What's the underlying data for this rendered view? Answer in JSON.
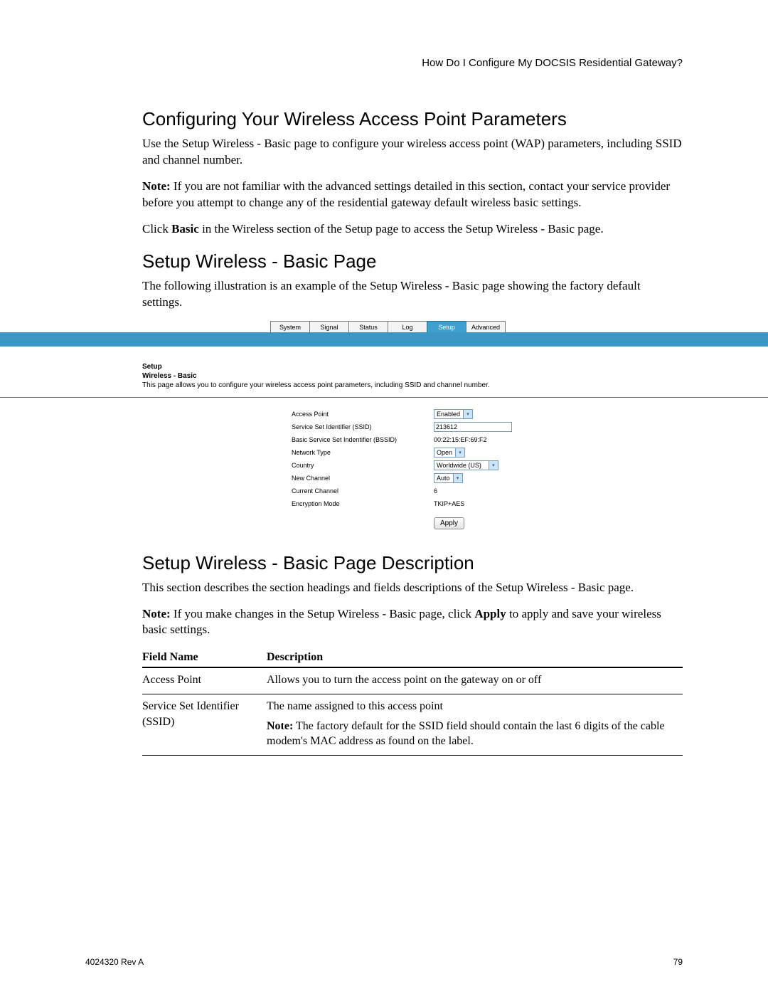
{
  "header": {
    "running": "How Do I Configure My DOCSIS Residential Gateway?"
  },
  "section1": {
    "heading": "Configuring Your Wireless Access Point Parameters",
    "p1": "Use the Setup Wireless - Basic page to configure your wireless access point (WAP) parameters, including SSID and channel number.",
    "p2_prefix": "Note:",
    "p2": " If you are not familiar with the advanced settings detailed in this section, contact your service provider before you attempt to change any of the residential gateway default wireless basic settings.",
    "p3_a": "Click ",
    "p3_bold": "Basic",
    "p3_b": " in the Wireless section of the Setup page to access the Setup Wireless - Basic page."
  },
  "section2": {
    "heading": "Setup Wireless - Basic Page",
    "p1": "The following illustration is an example of the Setup Wireless - Basic page showing the factory default settings."
  },
  "ui": {
    "tabs": {
      "system": "System",
      "signal": "Signal",
      "status": "Status",
      "log": "Log",
      "setup": "Setup",
      "advanced": "Advanced"
    },
    "titleblock": {
      "line1": "Setup",
      "line2": "Wireless - Basic",
      "desc": "This page allows you to configure your wireless access point parameters, including SSID and channel number."
    },
    "rows": {
      "access_point": {
        "label": "Access Point",
        "value": "Enabled"
      },
      "ssid": {
        "label": "Service Set Identifier (SSID)",
        "value": "213612"
      },
      "bssid": {
        "label": "Basic Service Set Indentifier (BSSID)",
        "value": "00:22:15:EF:69:F2"
      },
      "network_type": {
        "label": "Network Type",
        "value": "Open"
      },
      "country": {
        "label": "Country",
        "value": "Worldwide (US)"
      },
      "new_channel": {
        "label": "New Channel",
        "value": "Auto"
      },
      "current_channel": {
        "label": "Current Channel",
        "value": "6"
      },
      "encryption": {
        "label": "Encryption Mode",
        "value": "TKIP+AES"
      }
    },
    "apply": "Apply"
  },
  "section3": {
    "heading": "Setup Wireless - Basic Page Description",
    "p1": "This section describes the section headings and fields descriptions of the Setup Wireless - Basic page.",
    "p2_prefix": "Note:",
    "p2_a": " If you make changes in the Setup Wireless - Basic page, click ",
    "p2_bold": "Apply",
    "p2_b": " to apply and save your wireless basic settings."
  },
  "table": {
    "headers": {
      "field": "Field Name",
      "desc": "Description"
    },
    "rows": [
      {
        "field": "Access Point",
        "desc": "Allows you to turn the access point on the gateway on or off"
      },
      {
        "field": "Service Set Identifier (SSID)",
        "desc": "The name assigned to this access point",
        "note_prefix": "Note:",
        "note": " The factory default for the SSID field should contain the last 6 digits of the cable modem's MAC address as found on the label."
      }
    ]
  },
  "footer": {
    "left": "4024320 Rev A",
    "right": "79"
  }
}
